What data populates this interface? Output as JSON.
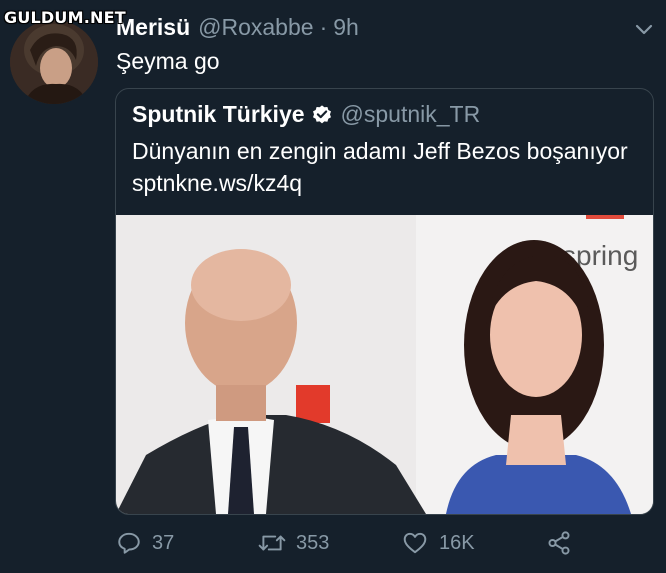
{
  "watermark": "GULDUM.NET",
  "tweet": {
    "display_name": "Merisü",
    "handle": "@Roxabbe",
    "separator": "·",
    "time": "9h",
    "text": "Şeyma go"
  },
  "quoted_tweet": {
    "display_name": "Sputnik Türkiye",
    "handle": "@sputnik_TR",
    "text": "Dünyanın en zengin adamı Jeff Bezos boşanıyor sptnkne.ws/kz4q",
    "photo_background_text": "spring"
  },
  "actions": {
    "reply_count": "37",
    "retweet_count": "353",
    "like_count": "16K"
  },
  "colors": {
    "background": "#15202b",
    "secondary_text": "#8899a6",
    "border": "#38444d"
  },
  "icons": [
    "chevron-down-icon",
    "verified-badge-icon",
    "reply-icon",
    "retweet-icon",
    "like-icon",
    "share-icon"
  ]
}
